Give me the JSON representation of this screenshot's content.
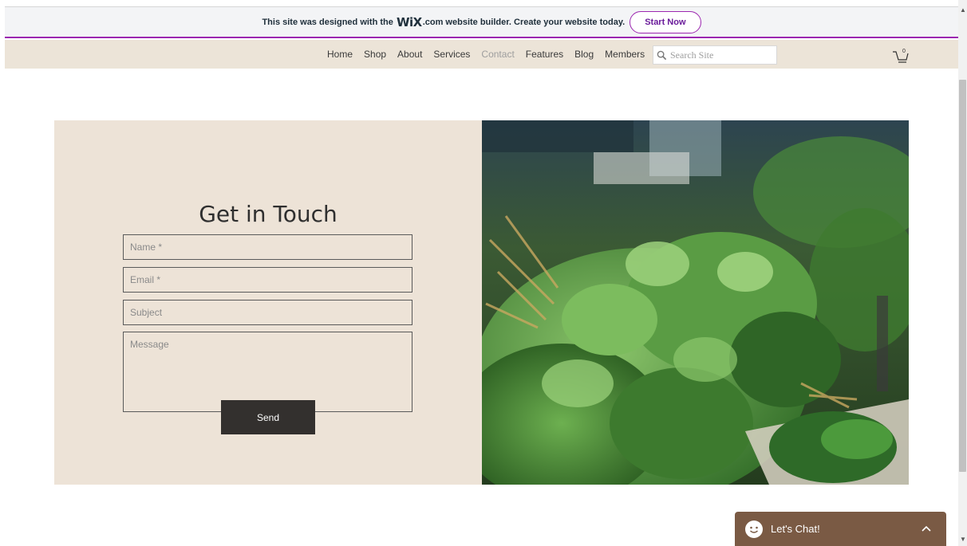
{
  "banner": {
    "text_before": "This site was designed with the",
    "wix_logo": "WiX",
    "text_after": ".com website builder. Create your website today.",
    "cta_label": "Start Now"
  },
  "nav": {
    "items": [
      {
        "label": "Home",
        "active": false
      },
      {
        "label": "Shop",
        "active": false
      },
      {
        "label": "About",
        "active": false
      },
      {
        "label": "Services",
        "active": false
      },
      {
        "label": "Contact",
        "active": true
      },
      {
        "label": "Features",
        "active": false
      },
      {
        "label": "Blog",
        "active": false
      },
      {
        "label": "Members",
        "active": false
      }
    ],
    "search_placeholder": "Search Site",
    "search_icon": "search-icon",
    "cart_icon": "cart-icon",
    "cart_count": "0"
  },
  "contact": {
    "title": "Get in Touch",
    "name_placeholder": "Name *",
    "email_placeholder": "Email *",
    "subject_placeholder": "Subject",
    "message_placeholder": "Message",
    "send_label": "Send"
  },
  "chat": {
    "label": "Let's Chat!",
    "icon": "smiley-icon",
    "toggle_icon": "chevron-up-icon"
  },
  "colors": {
    "banner_accent": "#9c27b0",
    "nav_bg": "#ece4d8",
    "contact_bg": "#ede3d7",
    "button_bg": "#33302e",
    "chat_bg": "#7a5a44"
  }
}
